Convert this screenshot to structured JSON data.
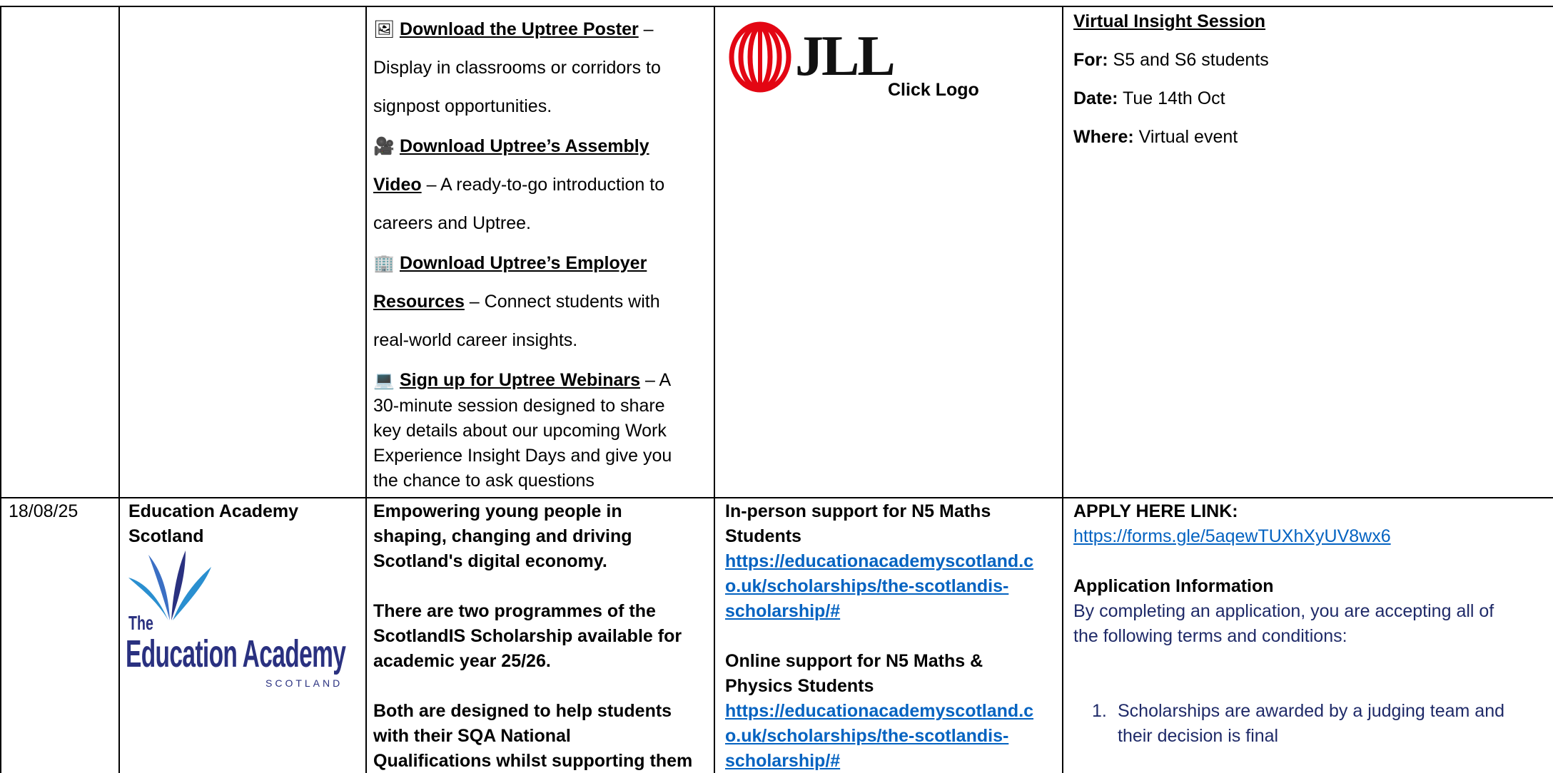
{
  "row1": {
    "col3": {
      "poster_icon": "poster-icon",
      "poster_link": "Download the Uptree Poster",
      "poster_rest_a": " –",
      "poster_rest_b": "Display in classrooms or corridors to",
      "poster_rest_c": "signpost opportunities.",
      "video_icon": "video-camera-icon",
      "video_link_a": "Download Uptree’s Assembly",
      "video_link_b": "Video",
      "video_rest_a": " – A ready-to-go introduction to",
      "video_rest_b": "careers and Uptree.",
      "employer_icon": "building-icon",
      "employer_link_a": "Download Uptree’s Employer",
      "employer_link_b": "Resources",
      "employer_rest_a": " – Connect students with",
      "employer_rest_b": "real-world career insights.",
      "webinar_icon": "laptop-icon",
      "webinar_link": "Sign up for Uptree Webinars",
      "webinar_rest_a": " – A",
      "webinar_lines": [
        "30-minute session designed to share",
        "key details about our upcoming Work",
        "Experience Insight Days and give you",
        "the chance to ask questions"
      ]
    },
    "col4": {
      "logo_text": "JLL",
      "click_logo": "Click Logo"
    },
    "col5": {
      "heading": "Virtual Insight Session",
      "for_label": "For:",
      "for_value": " S5 and S6 students",
      "date_label": "Date:",
      "date_value": " Tue 14th Oct",
      "where_label": "Where:",
      "where_value": " Virtual event"
    }
  },
  "row2": {
    "date": "18/08/25",
    "org_lines": [
      "Education Academy",
      "Scotland"
    ],
    "logo": {
      "the": "The",
      "name": "Education Academy",
      "sub": "SCOTLAND"
    },
    "desc": {
      "p1": [
        "Empowering young people in",
        "shaping, changing and driving",
        "Scotland's digital economy."
      ],
      "p2": [
        "There are two programmes of the",
        "ScotlandIS Scholarship available for",
        "academic year 25/26."
      ],
      "p3": [
        "Both are designed to help students",
        "with their SQA National",
        "Qualifications whilst supporting them"
      ]
    },
    "support": {
      "inperson_lines": [
        "In-person support for N5 Maths",
        "Students"
      ],
      "link1_lines": [
        "https://educationacademyscotland.c",
        "o.uk/scholarships/the-scotlandis-",
        "scholarship/#"
      ],
      "online_lines": [
        "Online support for N5 Maths &",
        "Physics Students"
      ],
      "link2_lines": [
        "https://educationacademyscotland.c",
        "o.uk/scholarships/the-scotlandis-",
        "scholarship/#"
      ]
    },
    "apply": {
      "label": "APPLY HERE LINK:",
      "url": "https://forms.gle/5aqewTUXhXyUV8wx6",
      "info_heading": "Application Information",
      "info_lines": [
        "By completing an application, you are accepting all of",
        "the following terms and conditions:"
      ],
      "item_num": "1.",
      "item_lines": [
        "Scholarships are awarded by a judging team and",
        "their decision is final"
      ]
    }
  },
  "colors": {
    "link_blue": "#0563c1",
    "navy_text": "#1f2a68",
    "jll_red": "#e30613",
    "logo_navy": "#2a3180",
    "logo_blue": "#2a8fd0"
  }
}
